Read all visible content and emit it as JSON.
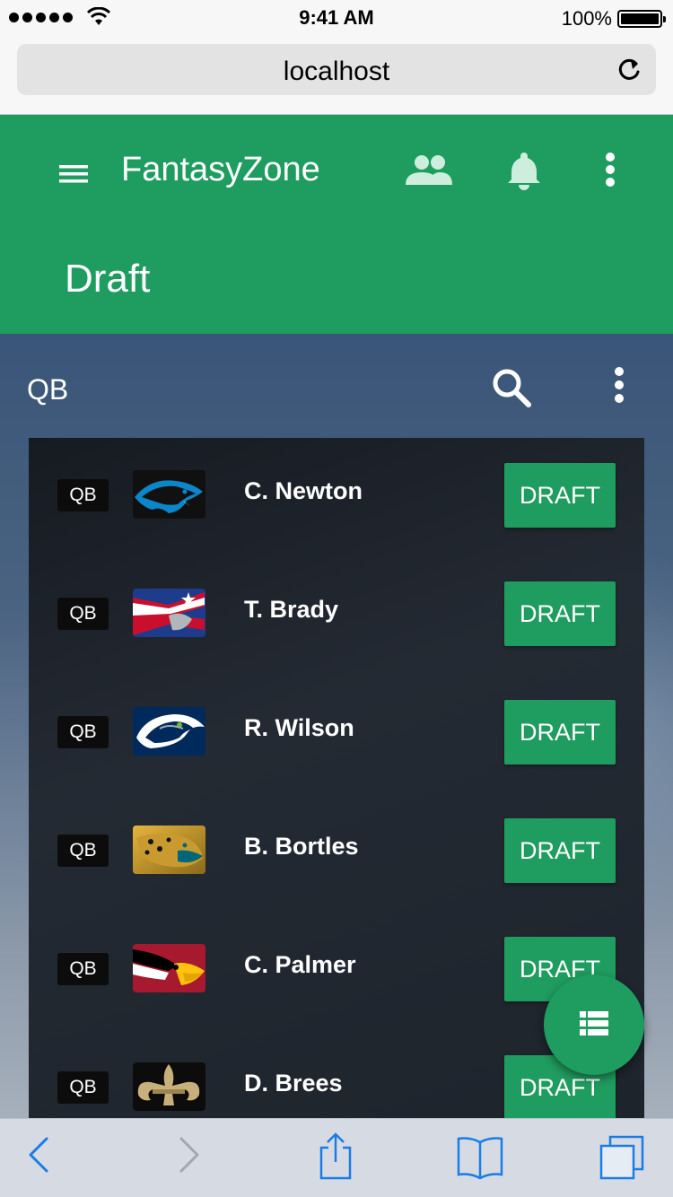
{
  "status_bar": {
    "time": "9:41 AM",
    "battery": "100%"
  },
  "browser": {
    "url": "localhost"
  },
  "header": {
    "app_title": "FantasyZone",
    "page_title": "Draft"
  },
  "toolbar": {
    "label": "QB"
  },
  "players": [
    {
      "position": "QB",
      "name": "C. Newton",
      "team": "panthers-logo",
      "action": "DRAFT"
    },
    {
      "position": "QB",
      "name": "T. Brady",
      "team": "patriots-logo",
      "action": "DRAFT"
    },
    {
      "position": "QB",
      "name": "R. Wilson",
      "team": "seahawks-logo",
      "action": "DRAFT"
    },
    {
      "position": "QB",
      "name": "B. Bortles",
      "team": "jaguars-logo",
      "action": "DRAFT"
    },
    {
      "position": "QB",
      "name": "C. Palmer",
      "team": "cardinals-logo",
      "action": "DRAFT"
    },
    {
      "position": "QB",
      "name": "D. Brees",
      "team": "saints-logo",
      "action": "DRAFT"
    }
  ],
  "colors": {
    "primary": "#1f9c5f",
    "panel": "#1e242c",
    "ios_blue": "#1a7ce6"
  }
}
